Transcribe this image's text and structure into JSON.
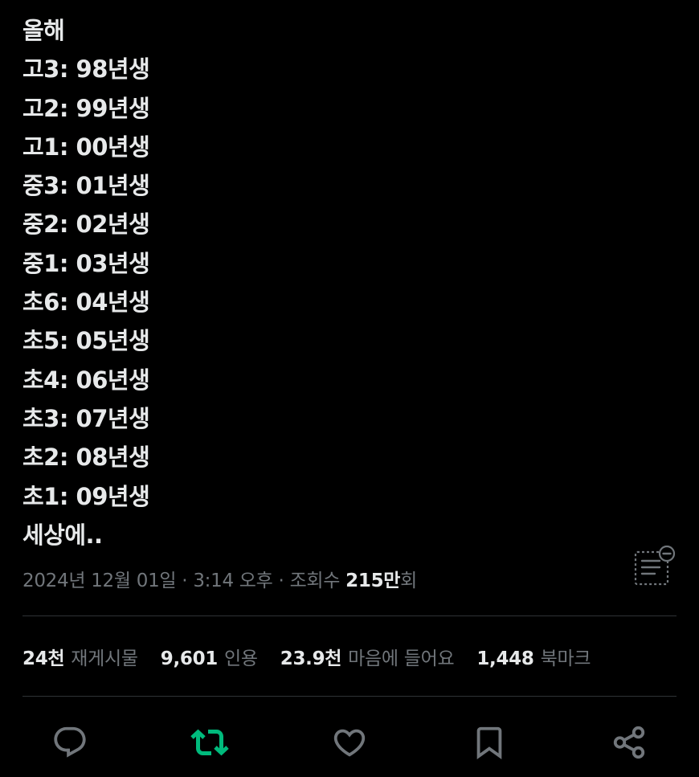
{
  "tweet": {
    "lines": [
      "올해",
      "고3: 98년생",
      "고2: 99년생",
      "고1: 00년생",
      "중3: 01년생",
      "중2: 02년생",
      "중1: 03년생",
      "초6: 04년생",
      "초5: 05년생",
      "초4: 06년생",
      "초3: 07년생",
      "초2: 08년생",
      "초1: 09년생",
      "세상에.."
    ]
  },
  "meta": {
    "date": "2024년 12월 01일",
    "separator1": " · ",
    "time": "3:14 오후",
    "separator2": " · ",
    "views_label": "조회수 ",
    "views_count": "215만",
    "views_suffix": "회"
  },
  "stats": [
    {
      "count": "24천",
      "label": "재게시물"
    },
    {
      "count": "9,601",
      "label": "인용"
    },
    {
      "count": "23.9천",
      "label": "마음에 들어요"
    },
    {
      "count": "1,448",
      "label": "북마크"
    }
  ],
  "icons": {
    "note": "community-note-icon",
    "reply": "reply-icon",
    "repost": "repost-icon",
    "like": "heart-icon",
    "bookmark": "bookmark-icon",
    "share": "share-icon"
  },
  "colors": {
    "background": "#000000",
    "text_primary": "#e7e9ea",
    "text_secondary": "#71767b",
    "divider": "#2f3336",
    "repost_active": "#00ba7c"
  }
}
